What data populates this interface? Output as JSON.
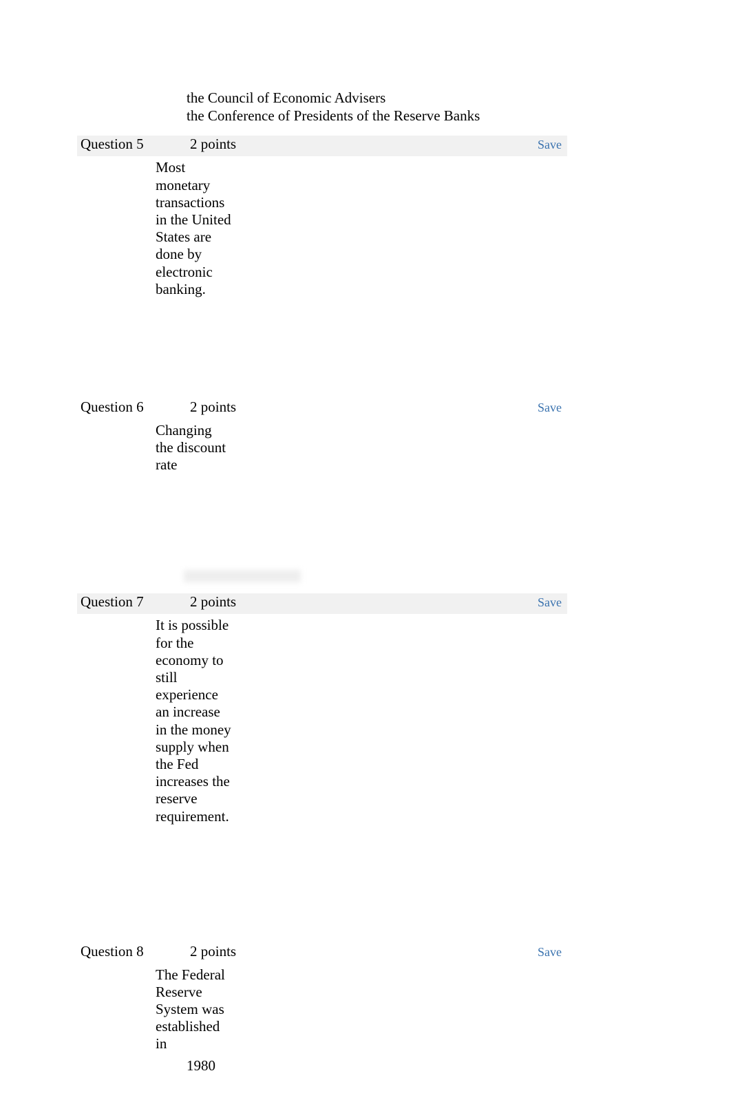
{
  "prior_options": {
    "opt3": "the Council of Economic Advisers",
    "opt4": "the Conference of Presidents of the Reserve Banks"
  },
  "questions": [
    {
      "label": "Question 5",
      "points": "2 points",
      "save": "Save",
      "text": "Most monetary transactions in the United States are done by electronic banking.",
      "shaded": true
    },
    {
      "label": "Question 6",
      "points": "2 points",
      "save": "Save",
      "text": "Changing the discount rate",
      "shaded": false
    },
    {
      "label": "Question 7",
      "points": "2 points",
      "save": "Save",
      "text": "It is possible for the economy to still experience an increase in the money supply when the Fed increases the reserve requirement.",
      "shaded": true
    },
    {
      "label": "Question 8",
      "points": "2 points",
      "save": "Save",
      "text": "The Federal Reserve System was established in",
      "option1": "1980",
      "shaded": false
    }
  ]
}
